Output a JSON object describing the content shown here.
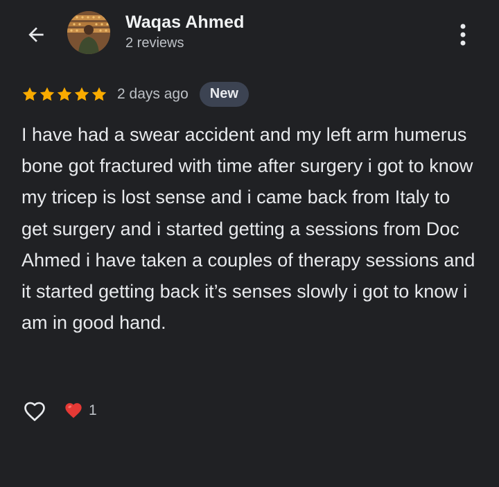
{
  "header": {
    "back_icon": "arrow-back-icon",
    "reviewer_name": "Waqas Ahmed",
    "review_count": "2 reviews",
    "more_icon": "more-vert-icon"
  },
  "review": {
    "rating": 5,
    "rating_max": 5,
    "date": "2 days ago",
    "badge": "New",
    "text": "I have had a swear accident and my left arm humerus bone got fractured with time after surgery i got to know my tricep is lost sense and i came back from Italy to get surgery and i started getting a sessions from Doc Ahmed i have taken a couples of therapy sessions and it started getting back it’s senses slowly i got to know i am in good hand."
  },
  "actions": {
    "like_icon": "heart-outline-icon",
    "reaction_icon": "red-heart-icon",
    "reaction_count": "1"
  },
  "colors": {
    "background": "#202124",
    "star": "#f9ab00",
    "badge_bg": "#3c4352",
    "reaction": "#e53935"
  }
}
